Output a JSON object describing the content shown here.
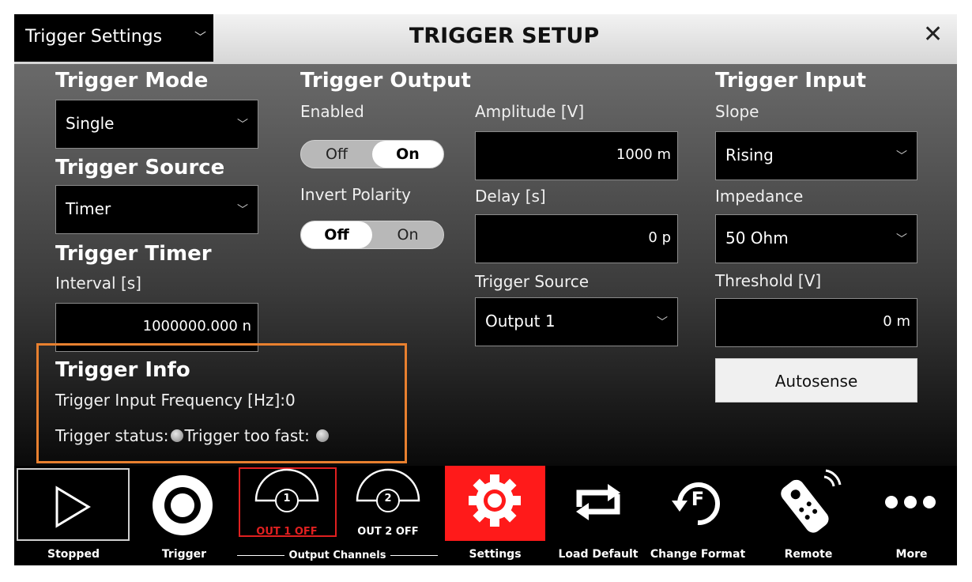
{
  "window": {
    "mode_selector": "Trigger Settings",
    "title": "TRIGGER SETUP",
    "close_glyph": "✕"
  },
  "trigger_mode": {
    "heading": "Trigger Mode",
    "value": "Single"
  },
  "trigger_source": {
    "heading": "Trigger Source",
    "value": "Timer"
  },
  "trigger_timer": {
    "heading": "Trigger Timer",
    "interval_label": "Interval [s]",
    "interval_value": "1000000.000 n"
  },
  "trigger_output": {
    "heading": "Trigger Output",
    "enabled_label": "Enabled",
    "enabled_off": "Off",
    "enabled_on": "On",
    "enabled_state": "On",
    "invert_label": "Invert Polarity",
    "invert_off": "Off",
    "invert_on": "On",
    "invert_state": "Off",
    "amplitude_label": "Amplitude [V]",
    "amplitude_value": "1000 m",
    "delay_label": "Delay [s]",
    "delay_value": "0 p",
    "source_label": "Trigger Source",
    "source_value": "Output 1"
  },
  "trigger_input": {
    "heading": "Trigger Input",
    "slope_label": "Slope",
    "slope_value": "Rising",
    "impedance_label": "Impedance",
    "impedance_value": "50 Ohm",
    "threshold_label": "Threshold [V]",
    "threshold_value": "0 m",
    "autosense_label": "Autosense"
  },
  "trigger_info": {
    "heading": "Trigger Info",
    "frequency_label": "Trigger Input Frequency  [Hz]:",
    "frequency_value": "0",
    "status_label": "Trigger status:",
    "too_fast_label": "Trigger too fast:"
  },
  "toolbar": {
    "stopped": "Stopped",
    "trigger": "Trigger",
    "out1_status": "OUT 1 OFF",
    "out1_num": "1",
    "out2_status": "OUT 2 OFF",
    "out2_num": "2",
    "output_channels": "Output Channels",
    "settings": "Settings",
    "load_default": "Load Default",
    "change_format": "Change Format",
    "change_format_letter": "F",
    "remote": "Remote",
    "more": "More"
  },
  "colors": {
    "accent_red": "#ff1a1a",
    "info_border": "#e8802f",
    "out1_red": "#e02020"
  }
}
